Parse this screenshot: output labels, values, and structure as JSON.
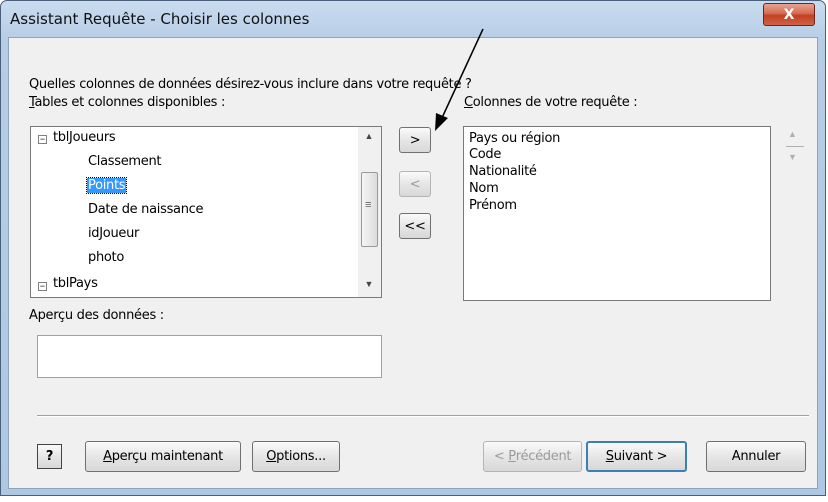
{
  "window": {
    "title": "Assistant Requête - Choisir les colonnes",
    "close_glyph": "X"
  },
  "prompt": "Quelles colonnes de données désirez-vous inclure dans votre requête ?",
  "available": {
    "label_accel": "T",
    "label_rest": "ables et colonnes disponibles :",
    "tree": [
      {
        "label": "tblJoueurs",
        "type": "table",
        "expander": "−"
      },
      {
        "label": "Classement",
        "type": "column"
      },
      {
        "label": "Points",
        "type": "column",
        "selected": true
      },
      {
        "label": "Date de naissance",
        "type": "column"
      },
      {
        "label": "idJoueur",
        "type": "column"
      },
      {
        "label": "photo",
        "type": "column"
      },
      {
        "label": "tblPays",
        "type": "table",
        "expander": "−"
      }
    ]
  },
  "move_buttons": {
    "add": ">",
    "remove": "<",
    "remove_all": "<<"
  },
  "query_columns": {
    "label_accel": "C",
    "label_rest": "olonnes de votre requête :",
    "items": [
      "Pays ou région",
      "Code",
      "Nationalité",
      "Nom",
      "Prénom"
    ]
  },
  "preview": {
    "label": "Aperçu des données :",
    "value": ""
  },
  "footer": {
    "help_glyph": "?",
    "preview_now_accel": "A",
    "preview_now_rest": "perçu maintenant",
    "options_accel": "O",
    "options_rest": "ptions...",
    "prev_prefix": "< ",
    "prev_accel": "P",
    "prev_rest": "récédent",
    "next_accel": "S",
    "next_rest": "uivant >",
    "cancel": "Annuler"
  },
  "colors": {
    "accent": "#3399ff",
    "close": "#c2401f"
  },
  "icons": {
    "scroll_up": "▲",
    "scroll_down": "▼",
    "scroll_grip": "≡"
  }
}
